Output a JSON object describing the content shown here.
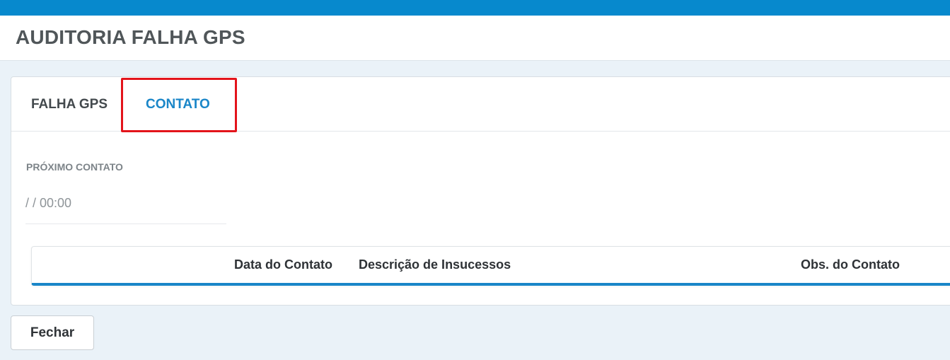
{
  "header": {
    "title": "AUDITORIA FALHA GPS"
  },
  "tabs": [
    {
      "label": "FALHA GPS",
      "active": false
    },
    {
      "label": "CONTATO",
      "active": true
    }
  ],
  "contact_form": {
    "next_contact_label": "PRÓXIMO CONTATO",
    "next_contact_value": "/ / 00:00"
  },
  "grid": {
    "columns": [
      "Data do Contato",
      "Descrição de Insucessos",
      "Obs. do Contato"
    ],
    "rows": []
  },
  "footer": {
    "close_label": "Fechar"
  },
  "colors": {
    "topbar": "#0789cd",
    "active_tab": "#1a86c8",
    "highlight": "#e3141b",
    "background": "#eaf2f8"
  }
}
